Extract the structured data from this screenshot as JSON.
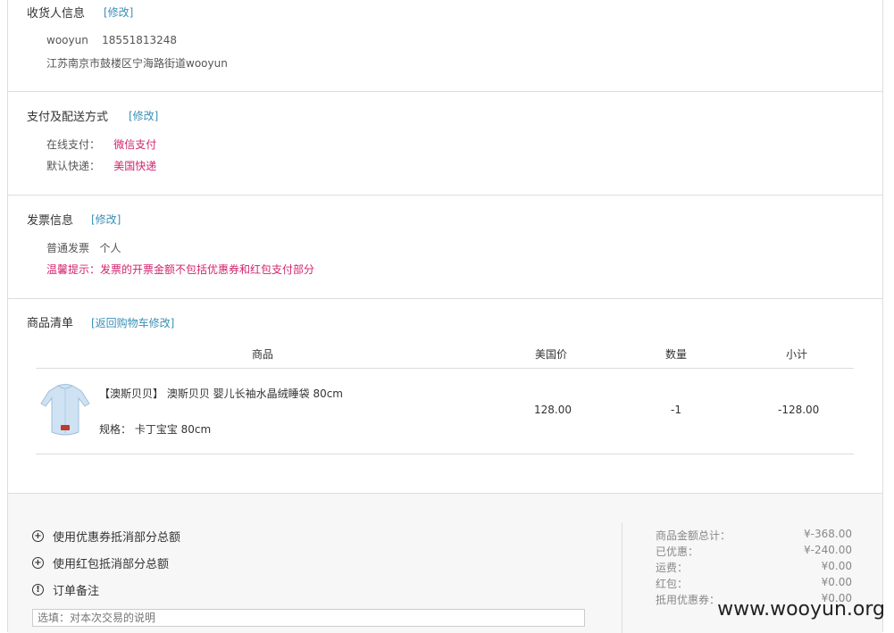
{
  "consignee": {
    "title": "收货人信息",
    "edit": "[修改]",
    "name": "wooyun",
    "phone": "18551813248",
    "address": "江苏南京市鼓楼区宁海路街道wooyun"
  },
  "payment": {
    "title": "支付及配送方式",
    "edit": "[修改]",
    "pay_label": "在线支付：",
    "pay_value": "微信支付",
    "ship_label": "默认快递：",
    "ship_value": "美国快递"
  },
  "invoice": {
    "title": "发票信息",
    "edit": "[修改]",
    "type": "普通发票",
    "owner": "个人",
    "notice": "温馨提示：发票的开票金额不包括优惠券和红包支付部分"
  },
  "goods": {
    "title": "商品清单",
    "edit": "[返回购物车修改]",
    "headers": {
      "product": "商品",
      "price": "美国价",
      "qty": "数量",
      "subtotal": "小计"
    },
    "items": [
      {
        "name": "【澳斯贝贝】 澳斯贝贝 婴儿长袖水晶绒睡袋 80cm",
        "spec": "规格： 卡丁宝宝   80cm",
        "price": "128.00",
        "qty": "-1",
        "subtotal": "-128.00"
      }
    ]
  },
  "options": {
    "coupon": "使用优惠券抵消部分总额",
    "redpacket": "使用红包抵消部分总额",
    "note": "订单备注",
    "note_placeholder": "选填：对本次交易的说明"
  },
  "summary": [
    {
      "label": "商品金额总计：",
      "value": "¥-368.00"
    },
    {
      "label": "已优惠：",
      "value": "¥-240.00"
    },
    {
      "label": "运费：",
      "value": "¥0.00"
    },
    {
      "label": "红包：",
      "value": "¥0.00"
    },
    {
      "label": "抵用优惠券：",
      "value": "¥0.00"
    }
  ],
  "watermark": "www.wooyun.org",
  "colors": {
    "accent_pink": "#d1246e",
    "link_blue": "#3a8fb7"
  }
}
